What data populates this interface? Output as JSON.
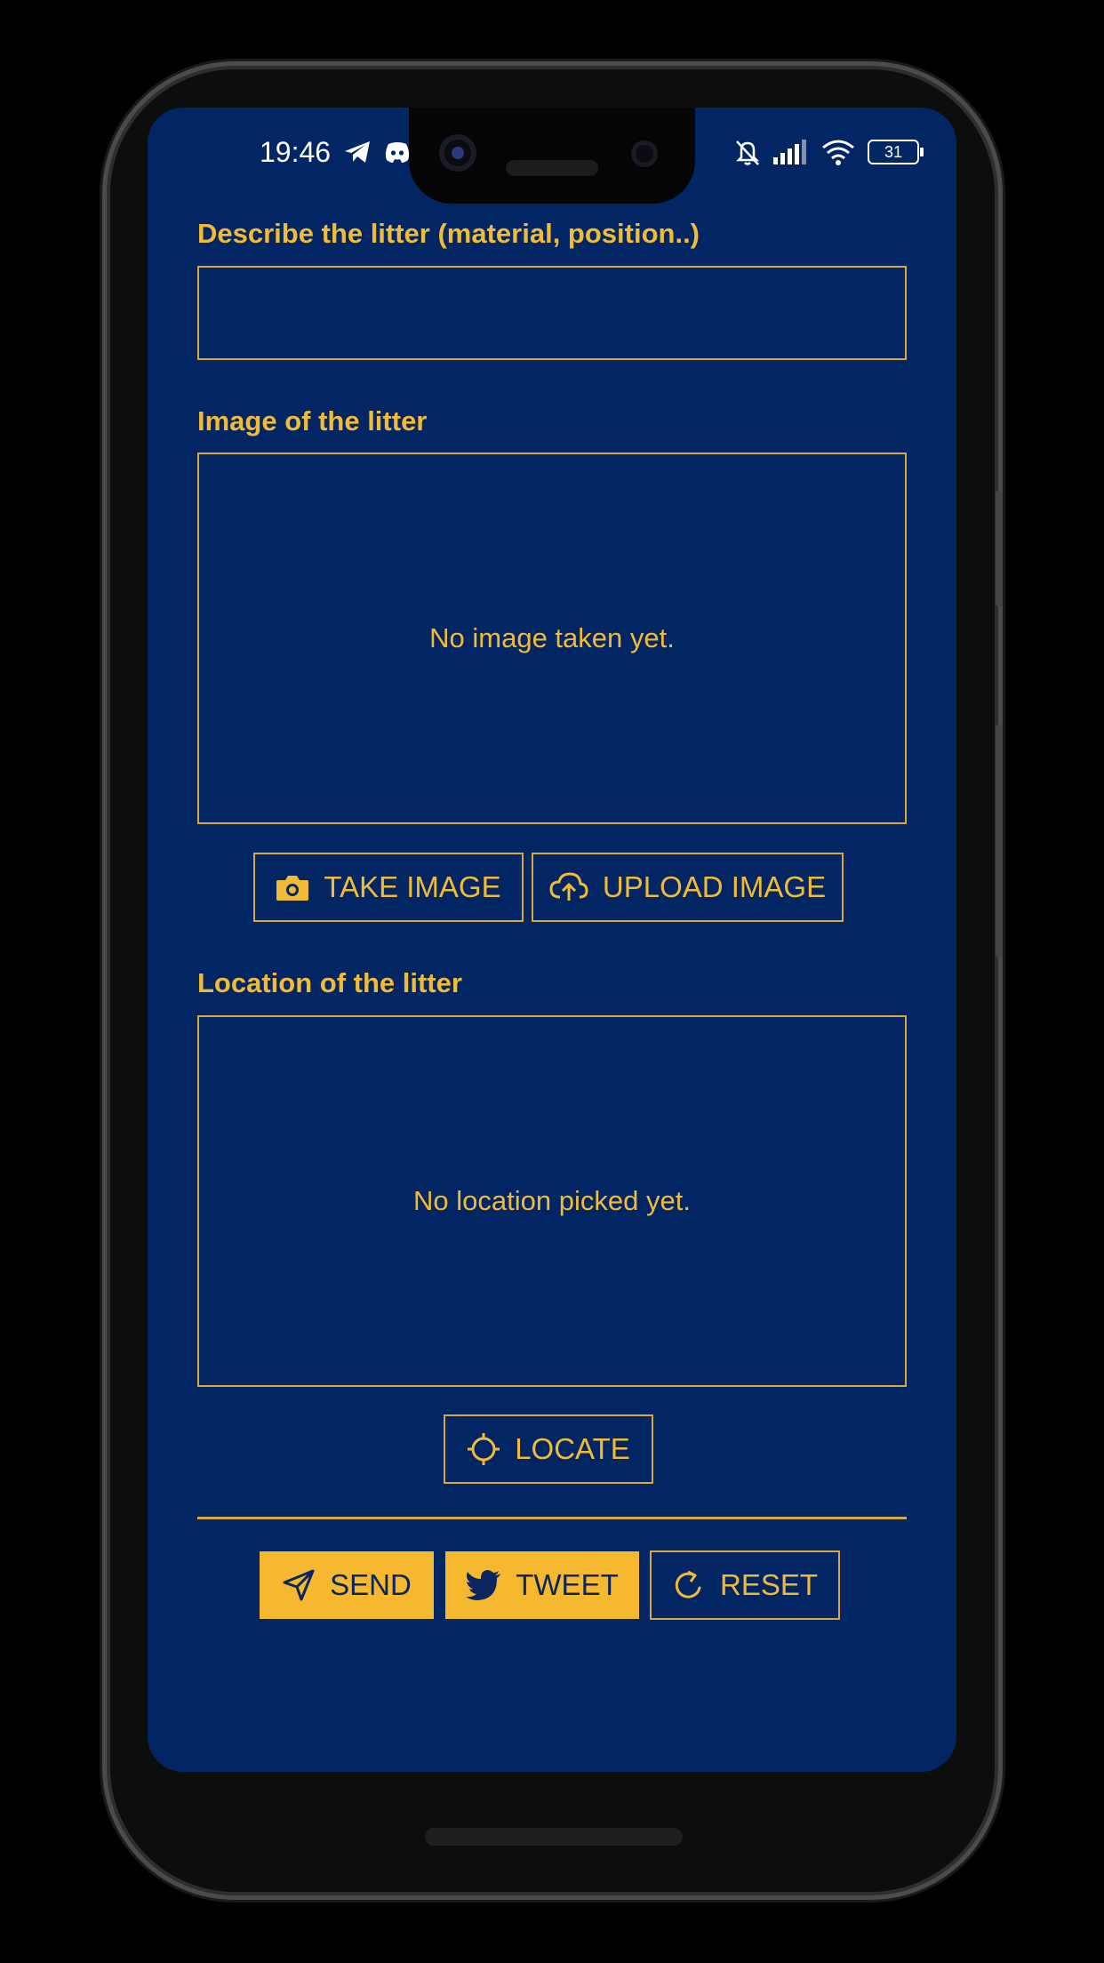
{
  "status_bar": {
    "time": "19:46",
    "battery": "31"
  },
  "form": {
    "description_label": "Describe the litter (material, position..)",
    "description_value": "",
    "image_label": "Image of the litter",
    "image_placeholder": "No image taken yet.",
    "take_image_label": "TAKE IMAGE",
    "upload_image_label": "UPLOAD IMAGE",
    "location_label": "Location of the litter",
    "location_placeholder": "No location picked yet.",
    "locate_label": "LOCATE"
  },
  "actions": {
    "send_label": "SEND",
    "tweet_label": "TWEET",
    "reset_label": "RESET"
  },
  "colors": {
    "background": "#022563",
    "accent": "#f5b82e"
  },
  "icons": [
    "telegram-icon",
    "discord-icon",
    "bell-off-icon",
    "signal-icon",
    "wifi-icon",
    "battery-icon",
    "camera-icon",
    "cloud-upload-icon",
    "crosshair-icon",
    "send-icon",
    "twitter-icon",
    "refresh-icon"
  ]
}
